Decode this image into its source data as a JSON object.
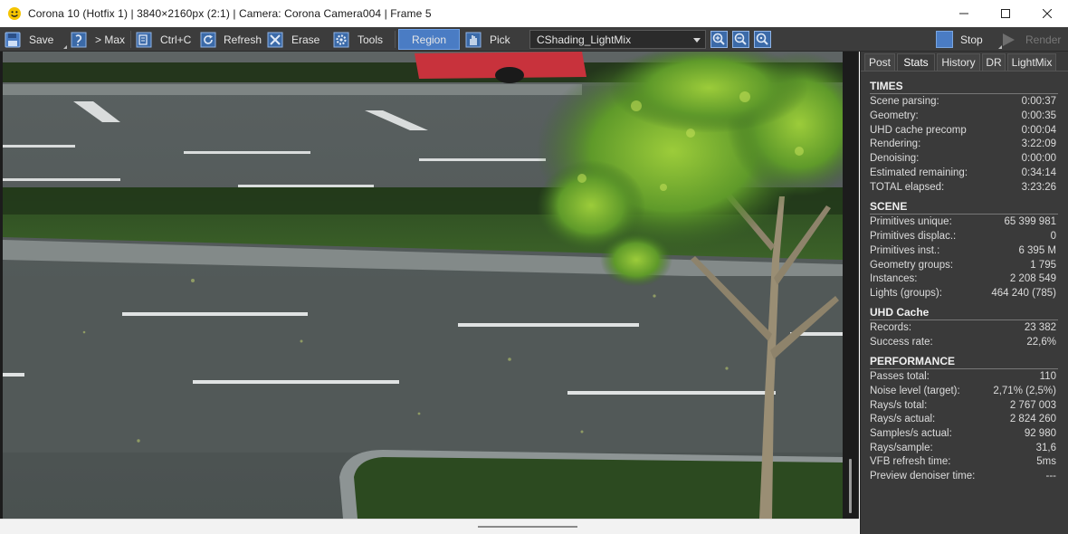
{
  "window": {
    "title": "Corona 10 (Hotfix 1) | 3840×2160px (2:1) | Camera: Corona Camera004 | Frame 5",
    "icon": "corona-sun-icon",
    "controls": [
      "minimize-icon",
      "maximize-icon",
      "close-icon"
    ]
  },
  "toolbar": {
    "save": "Save",
    "max": "> Max",
    "copy": "Ctrl+C",
    "refresh": "Refresh",
    "erase": "Erase",
    "tools": "Tools",
    "region": "Region",
    "pick": "Pick",
    "pass_selected": "CShading_LightMix",
    "stop": "Stop",
    "render": "Render",
    "accent": "#4a7cc4"
  },
  "panel": {
    "tabs": [
      "Post",
      "Stats",
      "History",
      "DR",
      "LightMix"
    ],
    "active_tab": "Stats",
    "sections": [
      {
        "title": "TIMES",
        "rows": [
          {
            "label": "Scene parsing:",
            "value": "0:00:37"
          },
          {
            "label": "Geometry:",
            "value": "0:00:35"
          },
          {
            "label": "UHD cache precomp",
            "value": "0:00:04"
          },
          {
            "label": "Rendering:",
            "value": "3:22:09"
          },
          {
            "label": "Denoising:",
            "value": "0:00:00"
          },
          {
            "label": "Estimated remaining:",
            "value": "0:34:14"
          },
          {
            "label": "TOTAL elapsed:",
            "value": "3:23:26"
          }
        ]
      },
      {
        "title": "SCENE",
        "rows": [
          {
            "label": "Primitives unique:",
            "value": "65 399 981"
          },
          {
            "label": "Primitives displac.:",
            "value": "0"
          },
          {
            "label": "Primitives inst.:",
            "value": "6 395 M"
          },
          {
            "label": "Geometry groups:",
            "value": "1 795"
          },
          {
            "label": "Instances:",
            "value": "2 208 549"
          },
          {
            "label": "Lights (groups):",
            "value": "464 240 (785)"
          }
        ]
      },
      {
        "title": "UHD Cache",
        "rows": [
          {
            "label": "Records:",
            "value": "23 382"
          },
          {
            "label": "Success rate:",
            "value": "22,6%"
          }
        ]
      },
      {
        "title": "PERFORMANCE",
        "rows": [
          {
            "label": "Passes total:",
            "value": "110"
          },
          {
            "label": "Noise level (target):",
            "value": "2,71% (2,5%)"
          },
          {
            "label": "Rays/s total:",
            "value": "2 767 003"
          },
          {
            "label": "Rays/s actual:",
            "value": "2 824 260"
          },
          {
            "label": "Samples/s actual:",
            "value": "92 980"
          },
          {
            "label": "Rays/sample:",
            "value": "31,6"
          },
          {
            "label": "VFB refresh time:",
            "value": "5ms"
          },
          {
            "label": "Preview denoiser time:",
            "value": "---"
          }
        ]
      }
    ]
  }
}
